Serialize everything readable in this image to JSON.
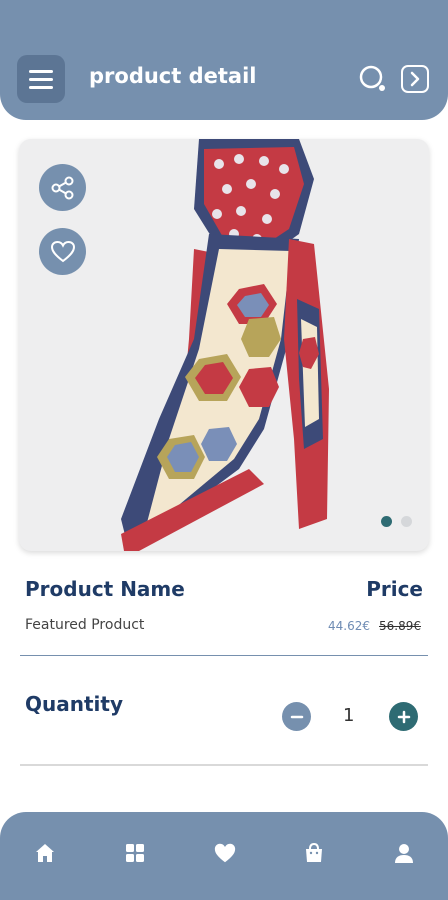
{
  "header": {
    "title": "product detail",
    "icons": {
      "menu": "menu-icon",
      "search": "search-icon",
      "next": "arrow-right-icon"
    }
  },
  "gallery": {
    "image": "scarf-product-image",
    "dots": [
      true,
      false
    ],
    "actions": {
      "share": "share-icon",
      "favorite": "heart-icon"
    }
  },
  "product": {
    "name": "Product Name",
    "price_title": "Price",
    "subtitle": "Featured Product",
    "price_new": "44.62€",
    "price_old": "56.89€"
  },
  "quantity": {
    "label": "Quantity",
    "value": "1"
  },
  "nav": [
    {
      "name": "home-icon"
    },
    {
      "name": "categories-icon"
    },
    {
      "name": "heart-icon"
    },
    {
      "name": "bag-icon"
    },
    {
      "name": "user-icon"
    }
  ],
  "colors": {
    "primary": "#7690ae",
    "accent": "#2e6b73",
    "title_text": "#1f3b66"
  }
}
